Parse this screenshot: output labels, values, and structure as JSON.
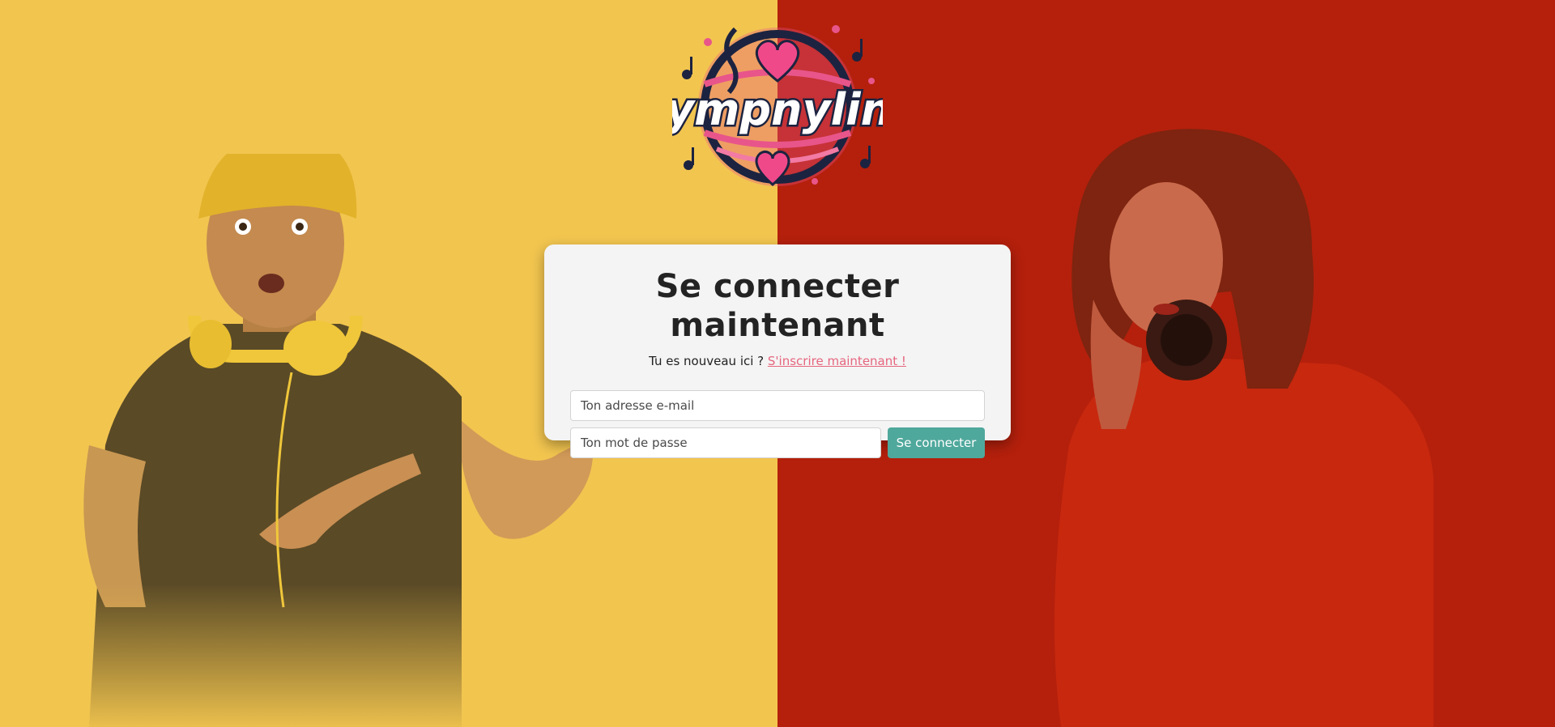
{
  "brand": {
    "logo_text": "Sympnylink"
  },
  "login": {
    "title": "Se connecter maintenant",
    "prompt": "Tu es nouveau ici ?",
    "signup_link": "S'inscrire maintenant !",
    "email_placeholder": "Ton adresse e-mail",
    "password_placeholder": "Ton mot de passe",
    "submit_label": "Se connecter"
  },
  "colors": {
    "left_background": "#f2c54f",
    "right_background": "#b4200c",
    "accent_button": "#4fa89c",
    "link": "#e6667f",
    "logo_pink": "#e8558a",
    "logo_navy": "#1c2340"
  }
}
